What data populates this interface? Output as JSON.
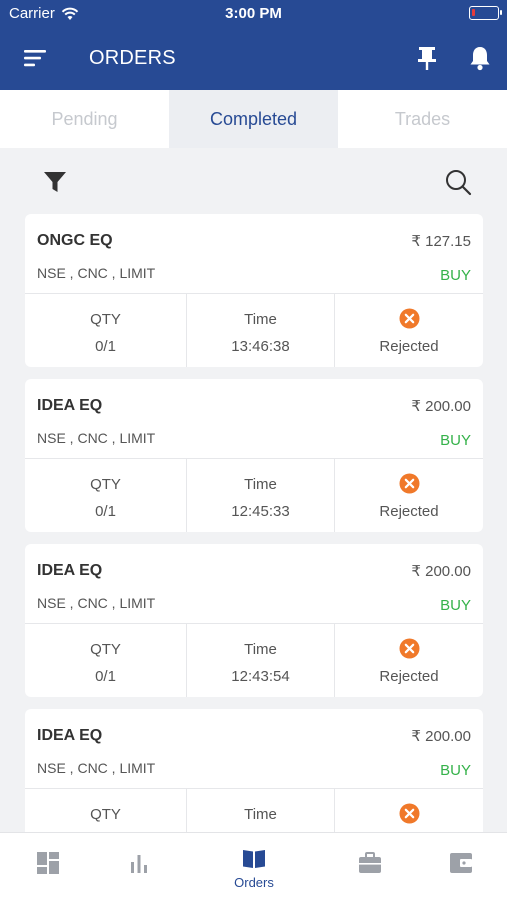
{
  "status_bar": {
    "carrier": "Carrier",
    "time": "3:00 PM",
    "battery_level": 0.15
  },
  "app_bar": {
    "title": "ORDERS",
    "icons": [
      "menu-icon",
      "pin-icon",
      "bell-icon"
    ]
  },
  "tabs": [
    {
      "label": "Pending",
      "active": false
    },
    {
      "label": "Completed",
      "active": true
    },
    {
      "label": "Trades",
      "active": false
    }
  ],
  "tools": {
    "icons": [
      "filter-icon",
      "search-icon"
    ]
  },
  "orders": [
    {
      "symbol": "ONGC EQ",
      "price": "₹ 127.15",
      "meta": "NSE , CNC , LIMIT",
      "side": "BUY",
      "qty_label": "QTY",
      "qty": "0/1",
      "time_label": "Time",
      "time": "13:46:38",
      "status": "Rejected"
    },
    {
      "symbol": "IDEA EQ",
      "price": "₹ 200.00",
      "meta": "NSE , CNC , LIMIT",
      "side": "BUY",
      "qty_label": "QTY",
      "qty": "0/1",
      "time_label": "Time",
      "time": "12:45:33",
      "status": "Rejected"
    },
    {
      "symbol": "IDEA EQ",
      "price": "₹ 200.00",
      "meta": "NSE , CNC , LIMIT",
      "side": "BUY",
      "qty_label": "QTY",
      "qty": "0/1",
      "time_label": "Time",
      "time": "12:43:54",
      "status": "Rejected"
    },
    {
      "symbol": "IDEA EQ",
      "price": "₹ 200.00",
      "meta": "NSE , CNC , LIMIT",
      "side": "BUY",
      "qty_label": "QTY",
      "time_label": "Time"
    }
  ],
  "bottom_nav": [
    {
      "icon": "dashboard-icon",
      "label": ""
    },
    {
      "icon": "chart-icon",
      "label": ""
    },
    {
      "icon": "orders-book-icon",
      "label": "Orders",
      "active": true
    },
    {
      "icon": "portfolio-briefcase-icon",
      "label": ""
    },
    {
      "icon": "wallet-icon",
      "label": ""
    }
  ],
  "colors": {
    "primary": "#274a94",
    "buy": "#35b24a",
    "rejected": "#f0792a",
    "background": "#f1f2f4"
  }
}
